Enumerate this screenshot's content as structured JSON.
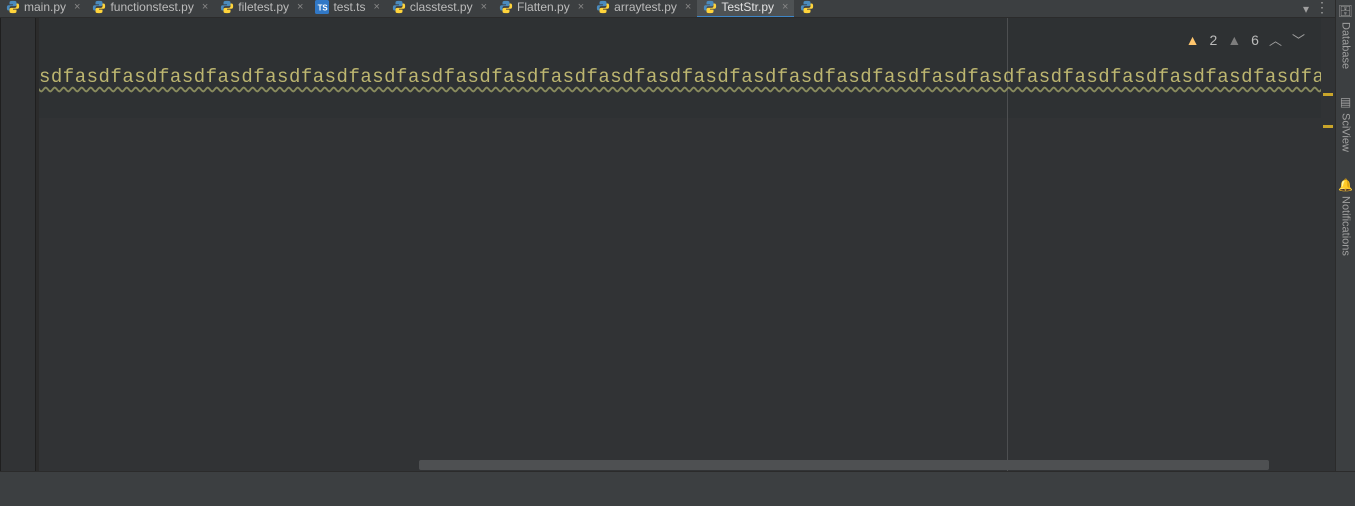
{
  "tabs": [
    {
      "label": "main.py",
      "type": "py",
      "active": false
    },
    {
      "label": "functionstest.py",
      "type": "py",
      "active": false
    },
    {
      "label": "filetest.py",
      "type": "py",
      "active": false
    },
    {
      "label": "test.ts",
      "type": "ts",
      "active": false
    },
    {
      "label": "classtest.py",
      "type": "py",
      "active": false
    },
    {
      "label": "Flatten.py",
      "type": "py",
      "active": false
    },
    {
      "label": "arraytest.py",
      "type": "py",
      "active": false
    },
    {
      "label": "TestStr.py",
      "type": "py",
      "active": true
    },
    {
      "label": "",
      "type": "py",
      "active": false
    }
  ],
  "inspections": {
    "warnings": "2",
    "weak": "6"
  },
  "code": {
    "line1": "sdfasdfasdfasdfasdfasdfasdfasdfasdfasdfasdfasdfasdfasdfasdfasdfasdfasdfasdfasdfasdfasdfasdfasdfasdfasdfasdfasdfa"
  },
  "right_tools": {
    "database": "Database",
    "sciview": "SciView",
    "notifications": "Notifications"
  },
  "colors": {
    "accent": "#3e86c7",
    "warning": "#c9a52a"
  }
}
